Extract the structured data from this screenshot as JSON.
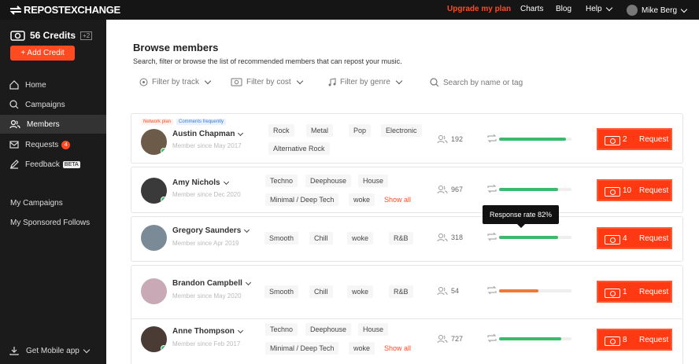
{
  "app": {
    "logo": "REPOSTEXCHANGE"
  },
  "topnav": {
    "upgrade": "Upgrade my plan",
    "charts": "Charts",
    "blog": "Blog",
    "help": "Help",
    "user": "Mike Berg"
  },
  "sidebar": {
    "credits": "56 Credits",
    "credits_plus": "+2",
    "add_credit": "+ Add Credit",
    "items": [
      {
        "label": "Home",
        "icon": "home-icon"
      },
      {
        "label": "Campaigns",
        "icon": "search-icon"
      },
      {
        "label": "Members",
        "icon": "users-icon"
      },
      {
        "label": "Requests",
        "icon": "inbox-icon",
        "badge": "4"
      },
      {
        "label": "Feedback",
        "icon": "edit-icon",
        "badge": "BETA"
      }
    ],
    "my_campaigns": "My Campaigns",
    "sponsored": "My Sponsored Follows",
    "mobile": "Get Mobile app"
  },
  "page": {
    "title": "Browse members",
    "subtitle": "Search, filter or browse the list of recommended members that can repost your music."
  },
  "filters": {
    "track": "Filter by track",
    "cost": "Filter by cost",
    "genre": "Filter by genre",
    "search_placeholder": "Search by name or tag"
  },
  "tooltip": "Response rate 82%",
  "members": [
    {
      "name": "Austin Chapman",
      "since": "Member since May 2017",
      "tag1": "Network plan",
      "tag2": "Comments frequently",
      "genres": [
        "Rock",
        "Metal",
        "Pop",
        "Electronic",
        "Alternative Rock"
      ],
      "followers": "192",
      "rate": 0.92,
      "rate_color": "#3cba6b",
      "cost": "2",
      "request": "Request"
    },
    {
      "name": "Amy Nichols",
      "since": "Member since Dec 2020",
      "genres": [
        "Techno",
        "Deephouse",
        "House",
        "Minimal / Deep Tech",
        "woke"
      ],
      "show_all": "Show all",
      "followers": "967",
      "rate": 0.82,
      "rate_color": "#3cba6b",
      "cost": "10",
      "request": "Request"
    },
    {
      "name": "Gregory Saunders",
      "since": "Member since Apr 2019",
      "genres": [
        "Smooth",
        "Chill",
        "woke",
        "R&B"
      ],
      "followers": "318",
      "rate": 0.82,
      "rate_color": "#3cba6b",
      "cost": "4",
      "request": "Request"
    },
    {
      "name": "Brandon Campbell",
      "since": "Member since May 2020",
      "genres": [
        "Smooth",
        "Chill",
        "woke",
        "R&B"
      ],
      "followers": "54",
      "rate": 0.54,
      "rate_color": "#ee7a3a",
      "cost": "1",
      "request": "Request"
    },
    {
      "name": "Anne Thompson",
      "since": "Member since Feb 2017",
      "genres": [
        "Techno",
        "Deephouse",
        "House",
        "Minimal / Deep Tech",
        "woke"
      ],
      "show_all": "Show all",
      "followers": "727",
      "rate": 0.86,
      "rate_color": "#3cba6b",
      "cost": "8",
      "request": "Request"
    }
  ]
}
